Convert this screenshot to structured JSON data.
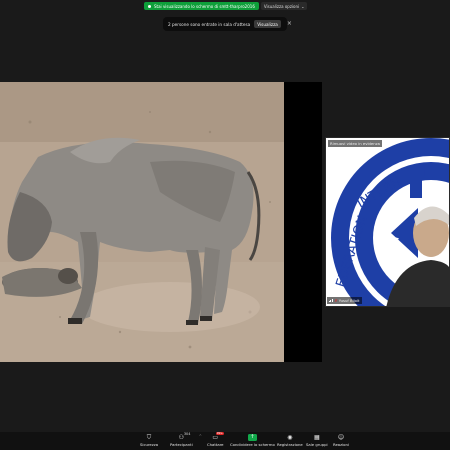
{
  "share_banner": {
    "text": "Stai visualizzando lo schermo di smtt-tharpro2016",
    "view_options_label": "Visualizza opzioni"
  },
  "waiting_room": {
    "message": "2 persone sono entrate in sala d'attesa",
    "view_button": "Visualizza",
    "close_glyph": "×"
  },
  "thumbnail": {
    "top_label": "Rimuovi video in evidenza",
    "name": "Yusuf Bilolt",
    "logo_text": [
      "EDERATION",
      "INTERN",
      "SCI",
      "F"
    ]
  },
  "toolbar": {
    "items": [
      {
        "label": "Sicurezza",
        "icon": "shield-icon"
      },
      {
        "label": "Partecipanti",
        "icon": "participants-icon",
        "count": "304"
      },
      {
        "label": "Chattare",
        "icon": "chat-icon",
        "badge": "99+"
      },
      {
        "label": "Condividere lo schermo",
        "icon": "share-screen-icon"
      },
      {
        "label": "Registrazione",
        "icon": "record-icon"
      },
      {
        "label": "Sale gruppi",
        "icon": "breakout-rooms-icon"
      },
      {
        "label": "Reazioni",
        "icon": "reactions-icon"
      }
    ]
  },
  "colors": {
    "share_green": "#0e9f3a",
    "badge_red": "#e02828",
    "background": "#1a1a1a"
  }
}
